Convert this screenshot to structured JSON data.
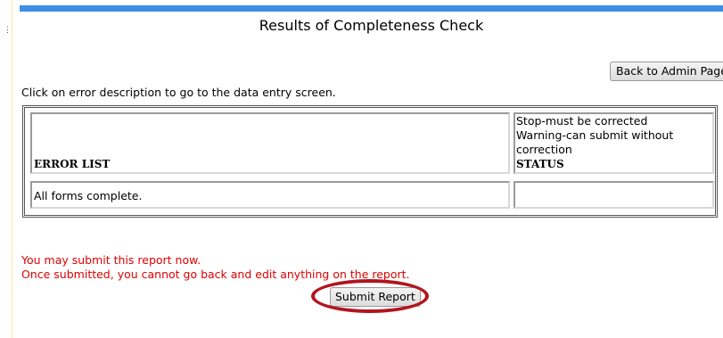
{
  "page": {
    "title": "Results of Completeness Check",
    "instruction": "Click on error description to go to the data entry screen."
  },
  "toolbar": {
    "back_label": "Back to Admin Page"
  },
  "table": {
    "headers": {
      "error_list": "ERROR LIST",
      "status_legend": [
        "Stop-must be corrected",
        "Warning-can submit without correction"
      ],
      "status": "STATUS"
    },
    "rows": [
      {
        "description": "All forms complete.",
        "status": ""
      }
    ]
  },
  "messages": {
    "line1": "You may submit this report now.",
    "line2": "Once submitted, you cannot go back and edit anything on the report."
  },
  "submit": {
    "label": "Submit Report"
  },
  "colors": {
    "accent_bar": "#3d8ee6",
    "message_text": "#e00000",
    "highlight_ring": "#b3141e"
  }
}
